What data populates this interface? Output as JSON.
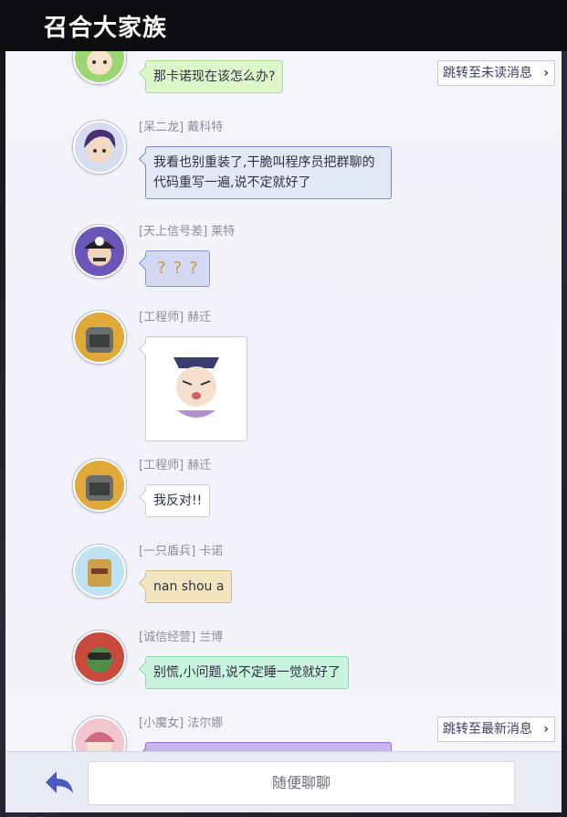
{
  "window": {
    "title": "召合大家族"
  },
  "buttons": {
    "jump_unread": "跳转至未读消息",
    "jump_latest": "跳转至最新消息",
    "arrow_glyph": "›"
  },
  "input": {
    "placeholder": "随便聊聊"
  },
  "messages": [
    {
      "sender": "",
      "text": "那卡诺现在该怎么办?",
      "bubble_color": "#dcf7c9"
    },
    {
      "sender": "[呆二龙] 戴科特",
      "text": "我看也别重装了,干脆叫程序员把群聊的代码重写一遍,说不定就好了",
      "bubble_color": "#e3e8f5"
    },
    {
      "sender": "[天上信号差] 莱特",
      "text": "",
      "content_type": "emoji",
      "emojis": [
        "confused-emoji",
        "confused-emoji",
        "confused-emoji"
      ],
      "bubble_color": "#d3d9f2"
    },
    {
      "sender": "[工程师] 赫迁",
      "text": "",
      "content_type": "sticker",
      "bubble_color": "#ffffff"
    },
    {
      "sender": "[工程师] 赫迁",
      "text": "我反对!!",
      "bubble_color": "#ffffff"
    },
    {
      "sender": "[一只盾兵] 卡诺",
      "text": "nan shou a",
      "bubble_color": "#f3e5bf"
    },
    {
      "sender": "[诚信经营] 兰博",
      "text": "别慌,小问题,说不定睡一觉就好了",
      "bubble_color": "#c9f5df"
    },
    {
      "sender": "[小魔女] 法尔娜",
      "text": "",
      "bubble_color": "#c7b6f0"
    }
  ],
  "icons": {
    "back": "back-arrow-icon",
    "jump_arrow": "chevron-right-icon"
  }
}
